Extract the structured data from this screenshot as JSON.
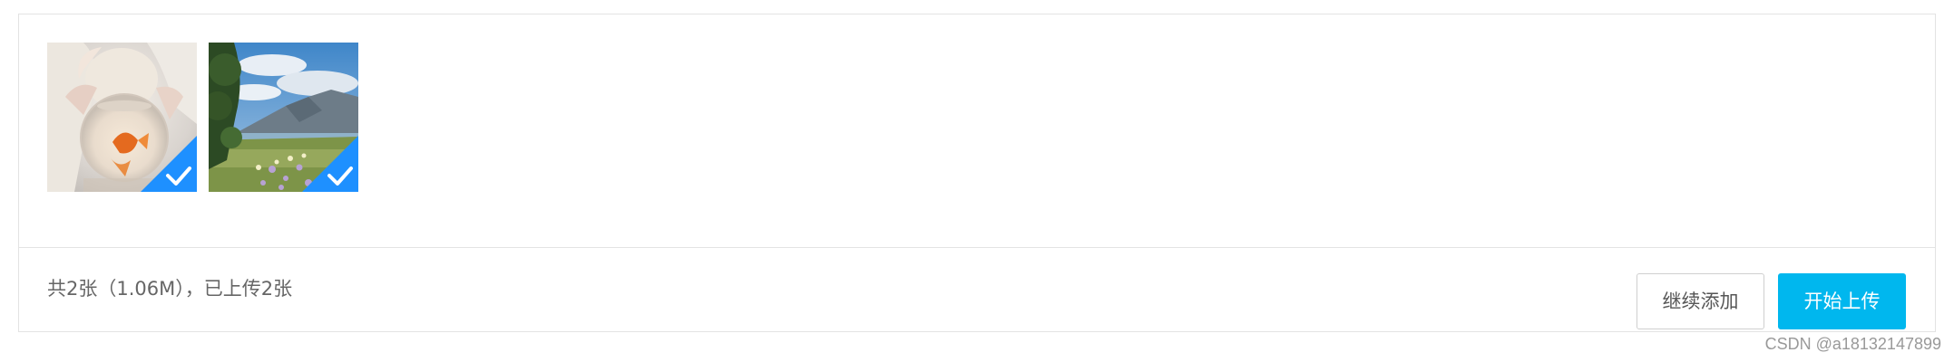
{
  "files": [
    {
      "name": "photo-goldfish-bowl",
      "status_icon": "check-icon",
      "uploaded": true
    },
    {
      "name": "photo-lake-landscape",
      "status_icon": "check-icon",
      "uploaded": true
    }
  ],
  "status": {
    "text": "共2张（1.06M），已上传2张"
  },
  "buttons": {
    "add_label": "继续添加",
    "upload_label": "开始上传"
  },
  "colors": {
    "accent": "#00b7ee",
    "check_badge": "#1e90ff",
    "border": "#e3e3e3",
    "text_muted": "#666666"
  },
  "watermark": "CSDN @a18132147899"
}
